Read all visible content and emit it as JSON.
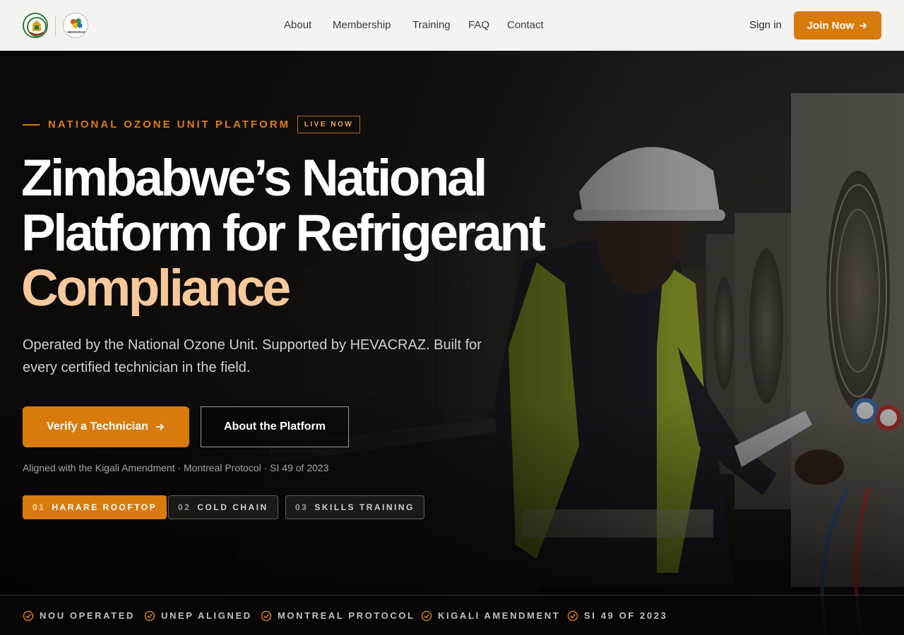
{
  "header": {
    "nav": [
      "About",
      "Membership",
      "Training",
      "FAQ",
      "Contact"
    ],
    "sign_in": "Sign in",
    "join": "Join Now",
    "logo_text": "HEVACRAZ"
  },
  "hero": {
    "eyebrow": "NATIONAL OZONE UNIT PLATFORM",
    "badge": "LIVE NOW",
    "title_line1": "Zimbabwe’s National",
    "title_line2": "Platform for Refrigerant",
    "title_line3": "Compliance",
    "subtitle": "Operated by the National Ozone Unit. Supported by HEVACRAZ. Built for every certified technician in the field.",
    "primary_cta": "Verify a Technician",
    "secondary_cta": "About the Platform",
    "aligned": "Aligned with the Kigali Amendment · Montreal Protocol · SI 49 of 2023",
    "chips": [
      {
        "num": "01",
        "label": "HARARE ROOFTOP"
      },
      {
        "num": "02",
        "label": "COLD CHAIN"
      },
      {
        "num": "03",
        "label": "SKILLS TRAINING"
      }
    ],
    "active_chip": 0
  },
  "trust": [
    "NOU OPERATED",
    "UNEP ALIGNED",
    "MONTREAL PROTOCOL",
    "KIGALI AMENDMENT",
    "SI 49 OF 2023"
  ],
  "colors": {
    "accent": "#d97a0c",
    "accent_light": "#f7c89a",
    "header_bg": "#f3f3f2",
    "hero_bg": "#0b0a09"
  },
  "icons": {
    "arrow": "arrow-right-icon",
    "check": "check-circle-icon",
    "logo_left": "zimbabwe-coat-of-arms-logo",
    "logo_right": "hevacraz-logo"
  }
}
